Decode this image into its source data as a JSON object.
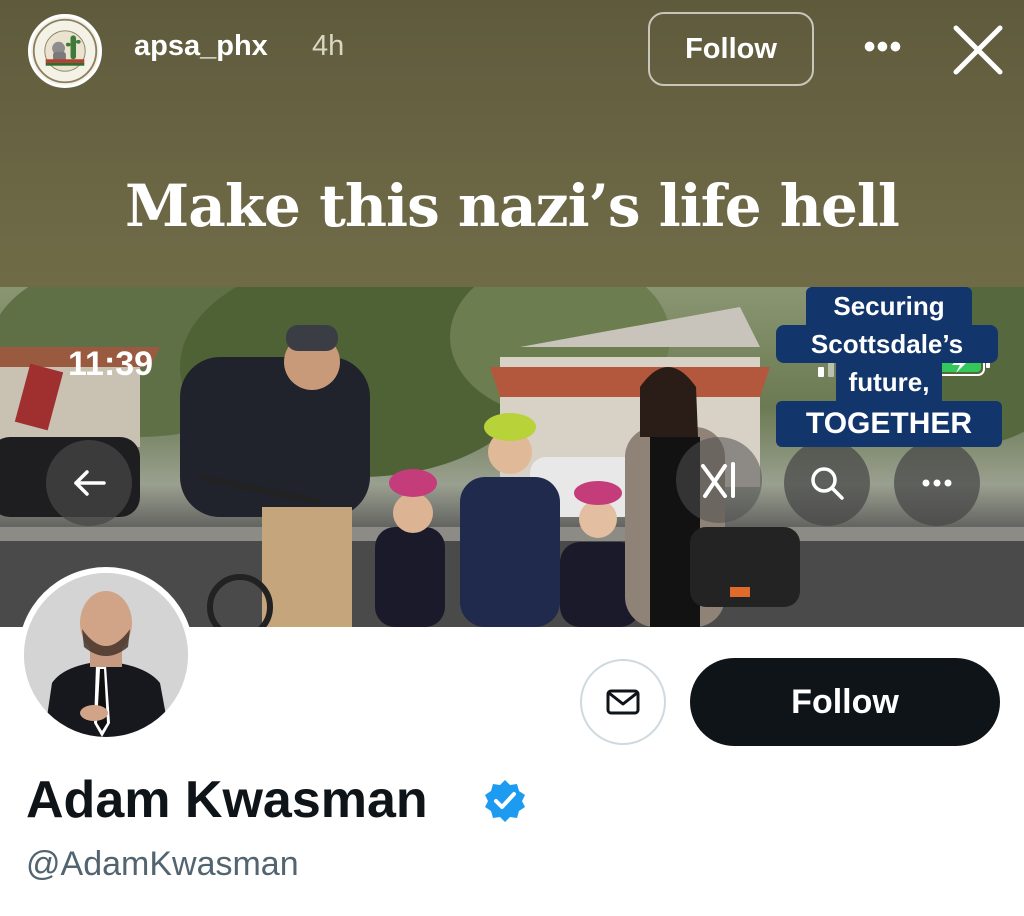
{
  "story": {
    "username": "apsa_phx",
    "time_ago": "4h",
    "follow_label": "Follow",
    "more_label": "•••",
    "caption": "Make this nazi’s life hell",
    "avatar_icon": "arizona-palestine-solidarity-alliance-logo",
    "close_icon": "close-icon"
  },
  "status_bar": {
    "time": "11:39",
    "icons": [
      "signal-icon",
      "wifi-icon",
      "battery-charging-icon"
    ]
  },
  "banner": {
    "sign_lines": [
      "Securing",
      "Scottsdale’s",
      "future,",
      "TOGETHER"
    ],
    "sign_color": "#12356b",
    "buttons": {
      "back_icon": "back-arrow-icon",
      "search_icon": "search-icon",
      "more_icon": "more-icon",
      "grok_icon": "x-ai-icon"
    }
  },
  "profile": {
    "name": "Adam Kwasman",
    "handle": "@AdamKwasman",
    "verified": true,
    "verified_color": "#1d9bf0",
    "follow_label": "Follow",
    "message_icon": "envelope-icon"
  }
}
